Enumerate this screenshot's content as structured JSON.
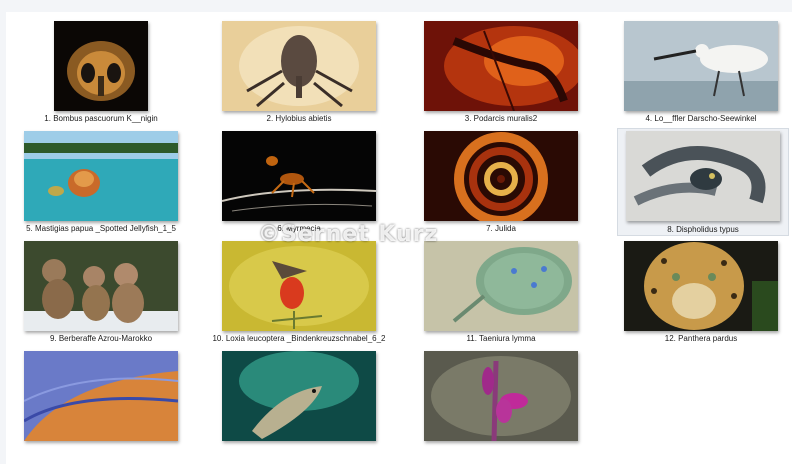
{
  "files": [
    {
      "label": "1. Bombus pascuorum K__nigin"
    },
    {
      "label": "2. Hylobius abietis"
    },
    {
      "label": "3. Podarcis muralis2"
    },
    {
      "label": "4. Lo__ffler Darscho-Seewinkel"
    },
    {
      "label": "5. Mastigias papua _Spotted Jellyfish_1_5"
    },
    {
      "label": "6. Myrmecia"
    },
    {
      "label": "7. Julida"
    },
    {
      "label": "8. Dispholidus typus"
    },
    {
      "label": "9. Berberaffe Azrou-Marokko"
    },
    {
      "label": "10. Loxia leucoptera _Bindenkreuzschnabel_6_2"
    },
    {
      "label": "11. Taeniura lymma"
    },
    {
      "label": "12. Panthera pardus"
    },
    {
      "label": ""
    },
    {
      "label": ""
    },
    {
      "label": ""
    }
  ],
  "watermark": "©Sernet Kurz"
}
